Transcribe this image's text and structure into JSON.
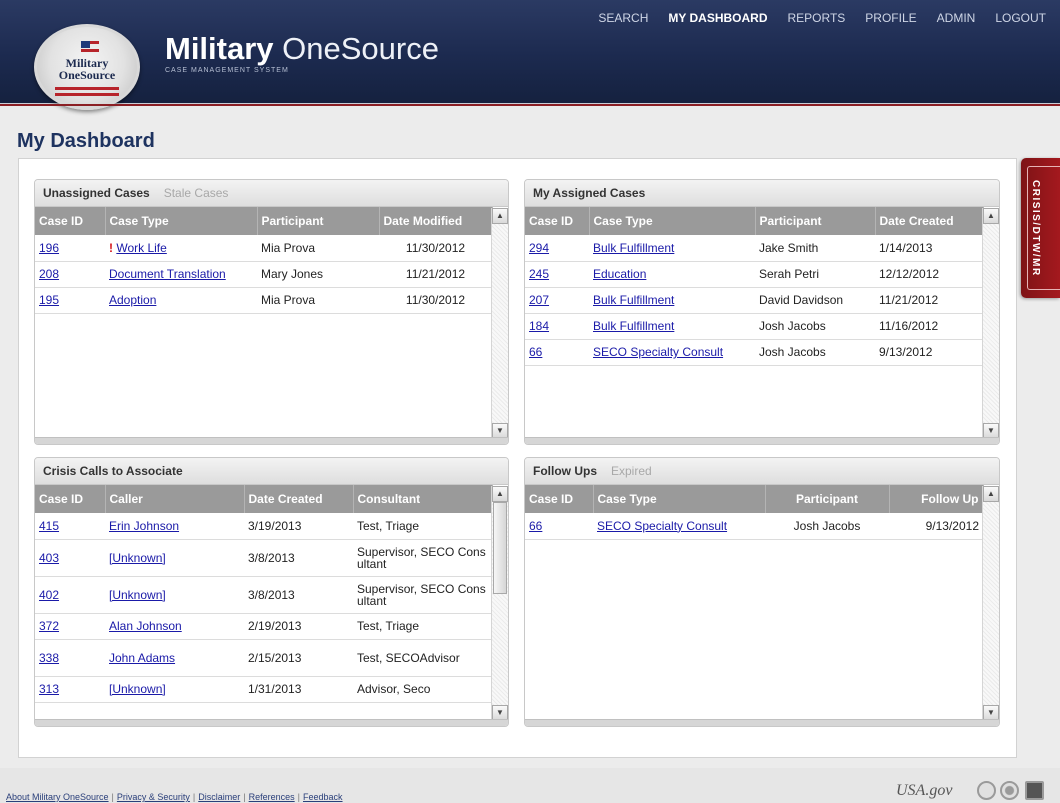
{
  "header": {
    "seal_line1": "Military",
    "seal_line2": "OneSource",
    "brand_bold": "Military",
    "brand_light": "OneSource",
    "brand_sub": "CASE MANAGEMENT SYSTEM",
    "nav": [
      "SEARCH",
      "MY DASHBOARD",
      "REPORTS",
      "PROFILE",
      "ADMIN",
      "LOGOUT"
    ],
    "active_nav": "MY DASHBOARD"
  },
  "page_title": "My Dashboard",
  "crisis_tab_label": "CRISIS/DTW/MR",
  "unassigned": {
    "tab_active": "Unassigned Cases",
    "tab_inactive": "Stale Cases",
    "columns": [
      "Case ID",
      "Case Type",
      "Participant",
      "Date Modified"
    ],
    "rows": [
      {
        "id": "196",
        "type": "Work Life",
        "flag": "!",
        "participant": "Mia Prova",
        "date": "11/30/2012"
      },
      {
        "id": "208",
        "type": "Document Translation",
        "flag": "",
        "participant": "Mary Jones",
        "date": "11/21/2012"
      },
      {
        "id": "195",
        "type": "Adoption",
        "flag": "",
        "participant": "Mia Prova",
        "date": "11/30/2012"
      }
    ]
  },
  "assigned": {
    "tab_active": "My Assigned Cases",
    "columns": [
      "Case ID",
      "Case Type",
      "Participant",
      "Date Created"
    ],
    "rows": [
      {
        "id": "294",
        "type": "Bulk Fulfillment",
        "participant": "Jake Smith",
        "date": "1/14/2013"
      },
      {
        "id": "245",
        "type": "Education",
        "participant": "Serah Petri",
        "date": "12/12/2012"
      },
      {
        "id": "207",
        "type": "Bulk Fulfillment",
        "participant": "David Davidson",
        "date": "11/21/2012"
      },
      {
        "id": "184",
        "type": "Bulk Fulfillment",
        "participant": "Josh Jacobs",
        "date": "11/16/2012"
      },
      {
        "id": "66",
        "type": "SECO Specialty Consult",
        "participant": "Josh Jacobs",
        "date": "9/13/2012"
      }
    ]
  },
  "crisis": {
    "tab_active": "Crisis Calls to Associate",
    "columns": [
      "Case ID",
      "Caller",
      "Date Created",
      "Consultant"
    ],
    "rows": [
      {
        "id": "415",
        "caller": "Erin Johnson",
        "date": "3/19/2013",
        "consultant": "Test, Triage"
      },
      {
        "id": "403",
        "caller": "[Unknown]",
        "date": "3/8/2013",
        "consultant": "Supervisor, SECO Consultant"
      },
      {
        "id": "402",
        "caller": "[Unknown]",
        "date": "3/8/2013",
        "consultant": "Supervisor, SECO Consultant"
      },
      {
        "id": "372",
        "caller": "Alan Johnson",
        "date": "2/19/2013",
        "consultant": "Test, Triage"
      },
      {
        "id": "338",
        "caller": "John Adams",
        "date": "2/15/2013",
        "consultant": "Test, SECOAdvisor"
      },
      {
        "id": "313",
        "caller": "[Unknown]",
        "date": "1/31/2013",
        "consultant": "Advisor, Seco"
      }
    ]
  },
  "followups": {
    "tab_active": "Follow Ups",
    "tab_inactive": "Expired",
    "columns": [
      "Case ID",
      "Case Type",
      "Participant",
      "Follow Up"
    ],
    "rows": [
      {
        "id": "66",
        "type": "SECO Specialty Consult",
        "participant": "Josh Jacobs",
        "date": "9/13/2012"
      }
    ]
  },
  "footer": {
    "links": [
      "About Military OneSource",
      "Privacy & Security",
      "Disclaimer",
      "References",
      "Feedback"
    ],
    "usagov": "USA.gov"
  },
  "colors": {
    "header_navy": "#1c2a4f",
    "title_blue": "#1e3360",
    "link_blue": "#1a1aa8",
    "crisis_red": "#a4191e",
    "flag_red": "#d4161c"
  }
}
